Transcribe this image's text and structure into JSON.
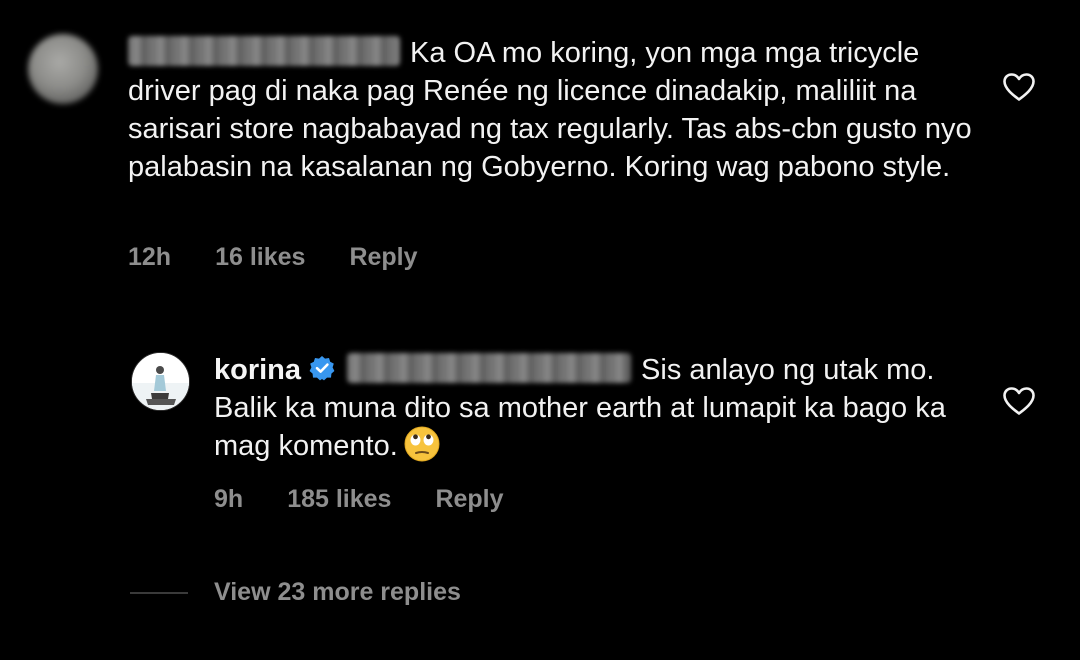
{
  "comments": [
    {
      "body": "Ka OA mo koring, yon mga mga tricycle driver pag di naka pag Renée ng licence dinadakip, maliliit na sarisari store nagbabayad ng tax regularly. Tas abs-cbn gusto nyo palabasin na kasalanan ng Gobyerno. Koring wag pabono style.",
      "time": "12h",
      "likes": "16 likes",
      "reply_label": "Reply",
      "like_icon": "heart-outline-icon"
    },
    {
      "username": "korina",
      "verified": true,
      "body": "Sis anlayo ng utak mo. Balik ka muna dito sa mother earth at lumapit ka bago ka mag komento.",
      "emoji": "face-with-rolling-eyes",
      "time": "9h",
      "likes": "185 likes",
      "reply_label": "Reply",
      "like_icon": "heart-outline-icon"
    }
  ],
  "view_replies_label": "View 23 more replies",
  "colors": {
    "background": "#000000",
    "text": "#f2f2f2",
    "secondary_text": "#8e8e8e",
    "verified_blue": "#3897f0"
  }
}
